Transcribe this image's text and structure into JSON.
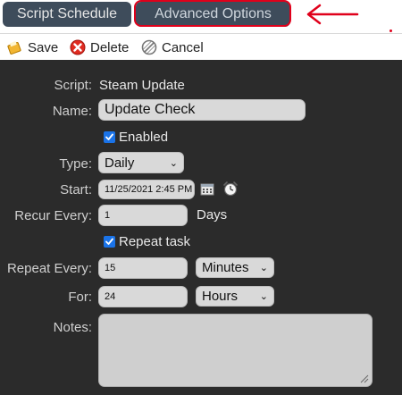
{
  "tabs": {
    "schedule": "Script Schedule",
    "advanced": "Advanced Options"
  },
  "toolbar": {
    "save": "Save",
    "delete": "Delete",
    "cancel": "Cancel"
  },
  "form": {
    "script_label": "Script:",
    "script_value": "Steam Update",
    "name_label": "Name:",
    "name_value": "Update Check",
    "enabled_label": "Enabled",
    "type_label": "Type:",
    "type_value": "Daily",
    "start_label": "Start:",
    "start_value": "11/25/2021 2:45 PM",
    "recur_label": "Recur Every:",
    "recur_value": "1",
    "recur_unit": "Days",
    "repeat_task_label": "Repeat task",
    "repeat_every_label": "Repeat Every:",
    "repeat_every_value": "15",
    "repeat_every_unit": "Minutes",
    "for_label": "For:",
    "for_value": "24",
    "for_unit": "Hours",
    "notes_label": "Notes:"
  },
  "colors": {
    "accent": "#e0001b",
    "tab": "#3e4c5b",
    "panel": "#2b2b2b"
  }
}
